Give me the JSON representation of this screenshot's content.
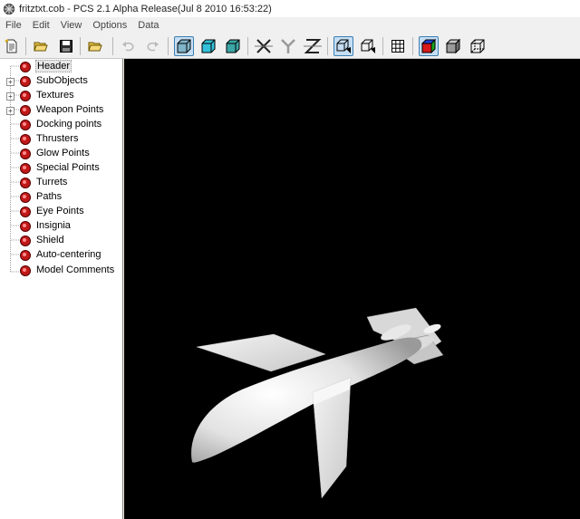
{
  "window": {
    "title": "fritztxt.cob - PCS 2.1 Alpha Release(Jul  8 2010 16:53:22)",
    "app_icon": "pcs-app-icon"
  },
  "menu": {
    "items": [
      "File",
      "Edit",
      "View",
      "Options",
      "Data"
    ]
  },
  "toolbar": {
    "buttons": [
      {
        "name": "new-file-icon",
        "pressed": false,
        "enabled": true
      },
      {
        "name": "open-folder-icon",
        "pressed": false,
        "enabled": true
      },
      {
        "name": "save-icon",
        "pressed": false,
        "enabled": true
      },
      {
        "name": "open-model-icon",
        "pressed": false,
        "enabled": true
      },
      {
        "name": "undo-icon",
        "pressed": false,
        "enabled": false
      },
      {
        "name": "redo-icon",
        "pressed": false,
        "enabled": false
      },
      {
        "name": "view-textured-box-icon",
        "pressed": true,
        "enabled": true
      },
      {
        "name": "view-box-cyan-icon",
        "pressed": false,
        "enabled": true
      },
      {
        "name": "view-box-teal-icon",
        "pressed": false,
        "enabled": true
      },
      {
        "name": "axis-x-icon",
        "pressed": false,
        "enabled": true
      },
      {
        "name": "axis-y-icon",
        "pressed": false,
        "enabled": true
      },
      {
        "name": "axis-z-icon",
        "pressed": false,
        "enabled": true
      },
      {
        "name": "camera-box-icon",
        "pressed": true,
        "enabled": true
      },
      {
        "name": "camera-box-2-icon",
        "pressed": false,
        "enabled": true
      },
      {
        "name": "grid-icon",
        "pressed": false,
        "enabled": true
      },
      {
        "name": "color-cube-icon",
        "pressed": true,
        "enabled": true
      },
      {
        "name": "solid-cube-icon",
        "pressed": false,
        "enabled": true
      },
      {
        "name": "wire-cube-icon",
        "pressed": false,
        "enabled": true
      }
    ]
  },
  "tree": {
    "items": [
      {
        "label": "Header",
        "expandable": false,
        "selected": true
      },
      {
        "label": "SubObjects",
        "expandable": true,
        "selected": false
      },
      {
        "label": "Textures",
        "expandable": true,
        "selected": false
      },
      {
        "label": "Weapon Points",
        "expandable": true,
        "selected": false
      },
      {
        "label": "Docking points",
        "expandable": false,
        "selected": false
      },
      {
        "label": "Thrusters",
        "expandable": false,
        "selected": false
      },
      {
        "label": "Glow Points",
        "expandable": false,
        "selected": false
      },
      {
        "label": "Special Points",
        "expandable": false,
        "selected": false
      },
      {
        "label": "Turrets",
        "expandable": false,
        "selected": false
      },
      {
        "label": "Paths",
        "expandable": false,
        "selected": false
      },
      {
        "label": "Eye Points",
        "expandable": false,
        "selected": false
      },
      {
        "label": "Insignia",
        "expandable": false,
        "selected": false
      },
      {
        "label": "Shield",
        "expandable": false,
        "selected": false
      },
      {
        "label": "Auto-centering",
        "expandable": false,
        "selected": false
      },
      {
        "label": "Model Comments",
        "expandable": false,
        "selected": false
      }
    ]
  },
  "colors": {
    "viewport_bg": "#000000",
    "tree_node": "#c01818",
    "toolbar_pressed": "#c5def5"
  }
}
